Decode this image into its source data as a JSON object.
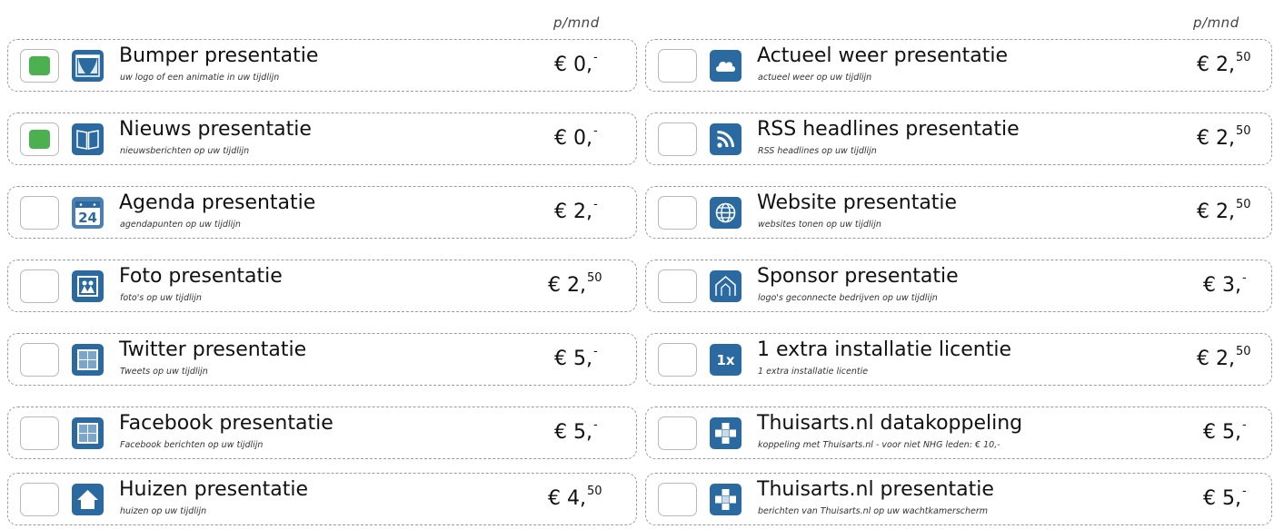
{
  "columns": [
    {
      "unit_label": "p/mnd",
      "items": [
        {
          "title": "Bumper presentatie",
          "subtitle": "uw logo of een animatie in uw tijdlijn",
          "price_main": "€ 0,",
          "price_sup": "-",
          "checked": true,
          "icon": "theater-curtain-icon"
        },
        {
          "title": "Nieuws presentatie",
          "subtitle": "nieuwsberichten op uw tijdlijn",
          "price_main": "€ 0,",
          "price_sup": "-",
          "checked": true,
          "icon": "open-book-icon"
        },
        {
          "title": "Agenda presentatie",
          "subtitle": "agendapunten op uw tijdlijn",
          "price_main": "€ 2,",
          "price_sup": "-",
          "checked": false,
          "icon": "calendar-icon",
          "icon_text": "24"
        },
        {
          "title": "Foto presentatie",
          "subtitle": "foto's op uw tijdlijn",
          "price_main": "€ 2,",
          "price_sup": "50",
          "checked": false,
          "icon": "photo-icon"
        },
        {
          "title": "Twitter presentatie",
          "subtitle": "Tweets op uw tijdlijn",
          "price_main": "€ 5,",
          "price_sup": "-",
          "checked": false,
          "icon": "grid-icon"
        },
        {
          "title": "Facebook presentatie",
          "subtitle": "Facebook berichten op uw tijdlijn",
          "price_main": "€ 5,",
          "price_sup": "-",
          "checked": false,
          "icon": "grid-icon"
        },
        {
          "title": "Huizen presentatie",
          "subtitle": "huizen op uw tijdlijn",
          "price_main": "€ 4,",
          "price_sup": "50",
          "checked": false,
          "icon": "house-icon"
        }
      ]
    },
    {
      "unit_label": "p/mnd",
      "items": [
        {
          "title": "Actueel weer presentatie",
          "subtitle": "actueel weer op uw tijdlijn",
          "price_main": "€ 2,",
          "price_sup": "50",
          "checked": false,
          "icon": "cloud-icon"
        },
        {
          "title": "RSS headlines presentatie",
          "subtitle": "RSS headlines op uw tijdlijn",
          "price_main": "€ 2,",
          "price_sup": "50",
          "checked": false,
          "icon": "rss-icon"
        },
        {
          "title": "Website presentatie",
          "subtitle": "websites tonen op uw tijdlijn",
          "price_main": "€ 2,",
          "price_sup": "50",
          "checked": false,
          "icon": "globe-icon"
        },
        {
          "title": "Sponsor presentatie",
          "subtitle": "logo's geconnecte bedrijven op uw tijdlijn",
          "price_main": "€ 3,",
          "price_sup": "-",
          "checked": false,
          "icon": "building-icon"
        },
        {
          "title": "1 extra installatie licentie",
          "subtitle": "1 extra installatie licentie",
          "price_main": "€ 2,",
          "price_sup": "50",
          "checked": false,
          "icon": "license-1x-icon",
          "icon_text": "1x"
        },
        {
          "title": "Thuisarts.nl datakoppeling",
          "subtitle": "koppeling met Thuisarts.nl - voor niet NHG leden: € 10,-",
          "price_main": "€ 5,",
          "price_sup": "-",
          "checked": false,
          "icon": "medical-cross-icon"
        },
        {
          "title": "Thuisarts.nl presentatie",
          "subtitle": "berichten van Thuisarts.nl op uw wachtkamerscherm",
          "price_main": "€ 5,",
          "price_sup": "-",
          "checked": false,
          "icon": "medical-cross-icon"
        }
      ]
    }
  ],
  "colors": {
    "accent": "#2a6aa0",
    "checked": "#4caf50",
    "border": "#9a9a9a"
  }
}
